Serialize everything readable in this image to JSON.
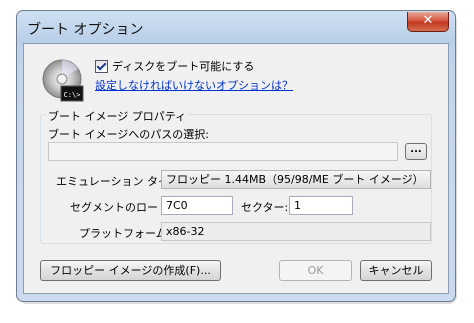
{
  "window": {
    "title": "ブート オプション",
    "close_glyph": "✕"
  },
  "bootable_checkbox": {
    "label": "ディスクをブート可能にする",
    "checked": true
  },
  "help_link": "設定しなければいけないオプションは？",
  "disc_icon": {
    "name": "disc-icon",
    "badge": "C:\\>"
  },
  "group": {
    "title": "ブート イメージ プロパティ",
    "path_label": "ブート イメージへのパスの選択:",
    "path_value": "",
    "browse_label": "...",
    "emulation_label": "エミュレーション タイプ:",
    "emulation_value": "フロッピー 1.44MB（95/98/ME ブート イメージ）",
    "segment_label": "セグメントのロード:",
    "segment_value": "7C0",
    "sector_label": "セクター:",
    "sector_value": "1",
    "platform_label": "プラットフォーム:",
    "platform_value": "x86-32"
  },
  "buttons": {
    "create_floppy": "フロッピー イメージの作成(F)...",
    "ok": "OK",
    "cancel": "キャンセル"
  },
  "colors": {
    "link": "#0033cc",
    "close_button": "#c13b22",
    "title_bar": "#b9cfe8"
  }
}
